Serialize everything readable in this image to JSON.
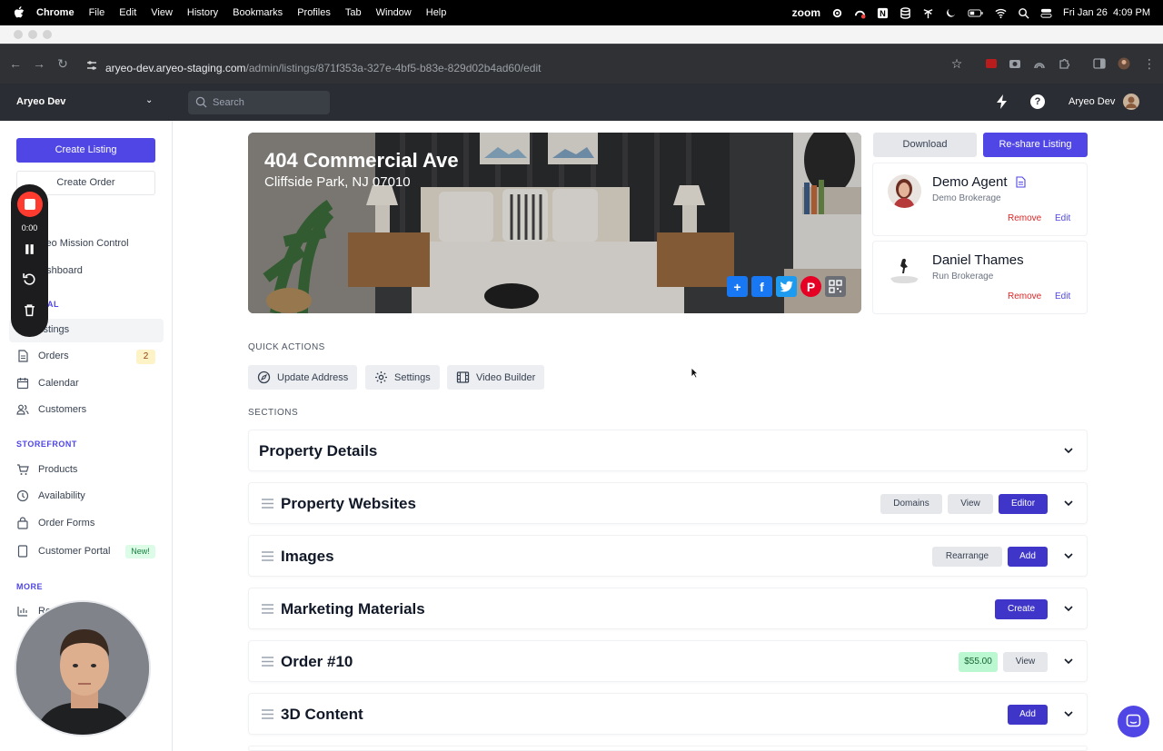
{
  "menubar": {
    "app": "Chrome",
    "items": [
      "File",
      "Edit",
      "View",
      "History",
      "Bookmarks",
      "Profiles",
      "Tab",
      "Window",
      "Help"
    ],
    "zoom_label": "zoom",
    "datetime": "Fri Jan 26  4:09 PM"
  },
  "browser": {
    "url_host": "aryeo-dev.aryeo-staging.com",
    "url_path": "/admin/listings/871f353a-327e-4bf5-b83e-829d02b4ad60/edit"
  },
  "header": {
    "org_name": "Aryeo Dev",
    "search_placeholder": "Search",
    "help_label": "?",
    "user_name": "Aryeo Dev"
  },
  "sidebar": {
    "create_listing": "Create Listing",
    "create_order": "Create Order",
    "items": [
      {
        "label": "yeo Mission Control"
      },
      {
        "label": "ashboard"
      },
      {
        "label": "istings"
      },
      {
        "label": "Orders"
      },
      {
        "label": "Calendar"
      },
      {
        "label": "Customers"
      },
      {
        "label": "Products"
      },
      {
        "label": "Availability"
      },
      {
        "label": "Order Forms"
      },
      {
        "label": "Customer Portal"
      },
      {
        "label": "Re"
      }
    ],
    "sections": [
      "AL",
      "STOREFRONT",
      "MORE"
    ],
    "orders_badge": "2",
    "portal_badge": "New!"
  },
  "recorder": {
    "time": "0:00"
  },
  "listing": {
    "address": "404 Commercial Ave",
    "city": "Cliffside Park, NJ 07010",
    "share_icons": [
      "plus-share-icon",
      "facebook-icon",
      "twitter-icon",
      "pinterest-icon",
      "qr-code-icon"
    ]
  },
  "actions": {
    "download": "Download",
    "reshare": "Re-share Listing"
  },
  "agents": [
    {
      "name": "Demo Agent",
      "brokerage": "Demo Brokerage",
      "remove": "Remove",
      "edit": "Edit"
    },
    {
      "name": "Daniel Thames",
      "brokerage": "Run Brokerage",
      "remove": "Remove",
      "edit": "Edit"
    }
  ],
  "quick_actions": {
    "title": "QUICK ACTIONS",
    "items": [
      "Update Address",
      "Settings",
      "Video Builder"
    ]
  },
  "sections": {
    "title": "SECTIONS",
    "rows": [
      {
        "title": "Property Details"
      },
      {
        "title": "Property Websites",
        "buttons": [
          "Domains",
          "View",
          "Editor"
        ]
      },
      {
        "title": "Images",
        "buttons": [
          "Rearrange",
          "Add"
        ]
      },
      {
        "title": "Marketing Materials",
        "buttons": [
          "Create"
        ]
      },
      {
        "title": "Order #10",
        "price": "$55.00",
        "buttons": [
          "View"
        ]
      },
      {
        "title": "3D Content",
        "buttons": [
          "Add"
        ]
      }
    ]
  },
  "colors": {
    "primary": "#4f46e5",
    "danger": "#dc2626",
    "app_header": "#2a2d33"
  }
}
